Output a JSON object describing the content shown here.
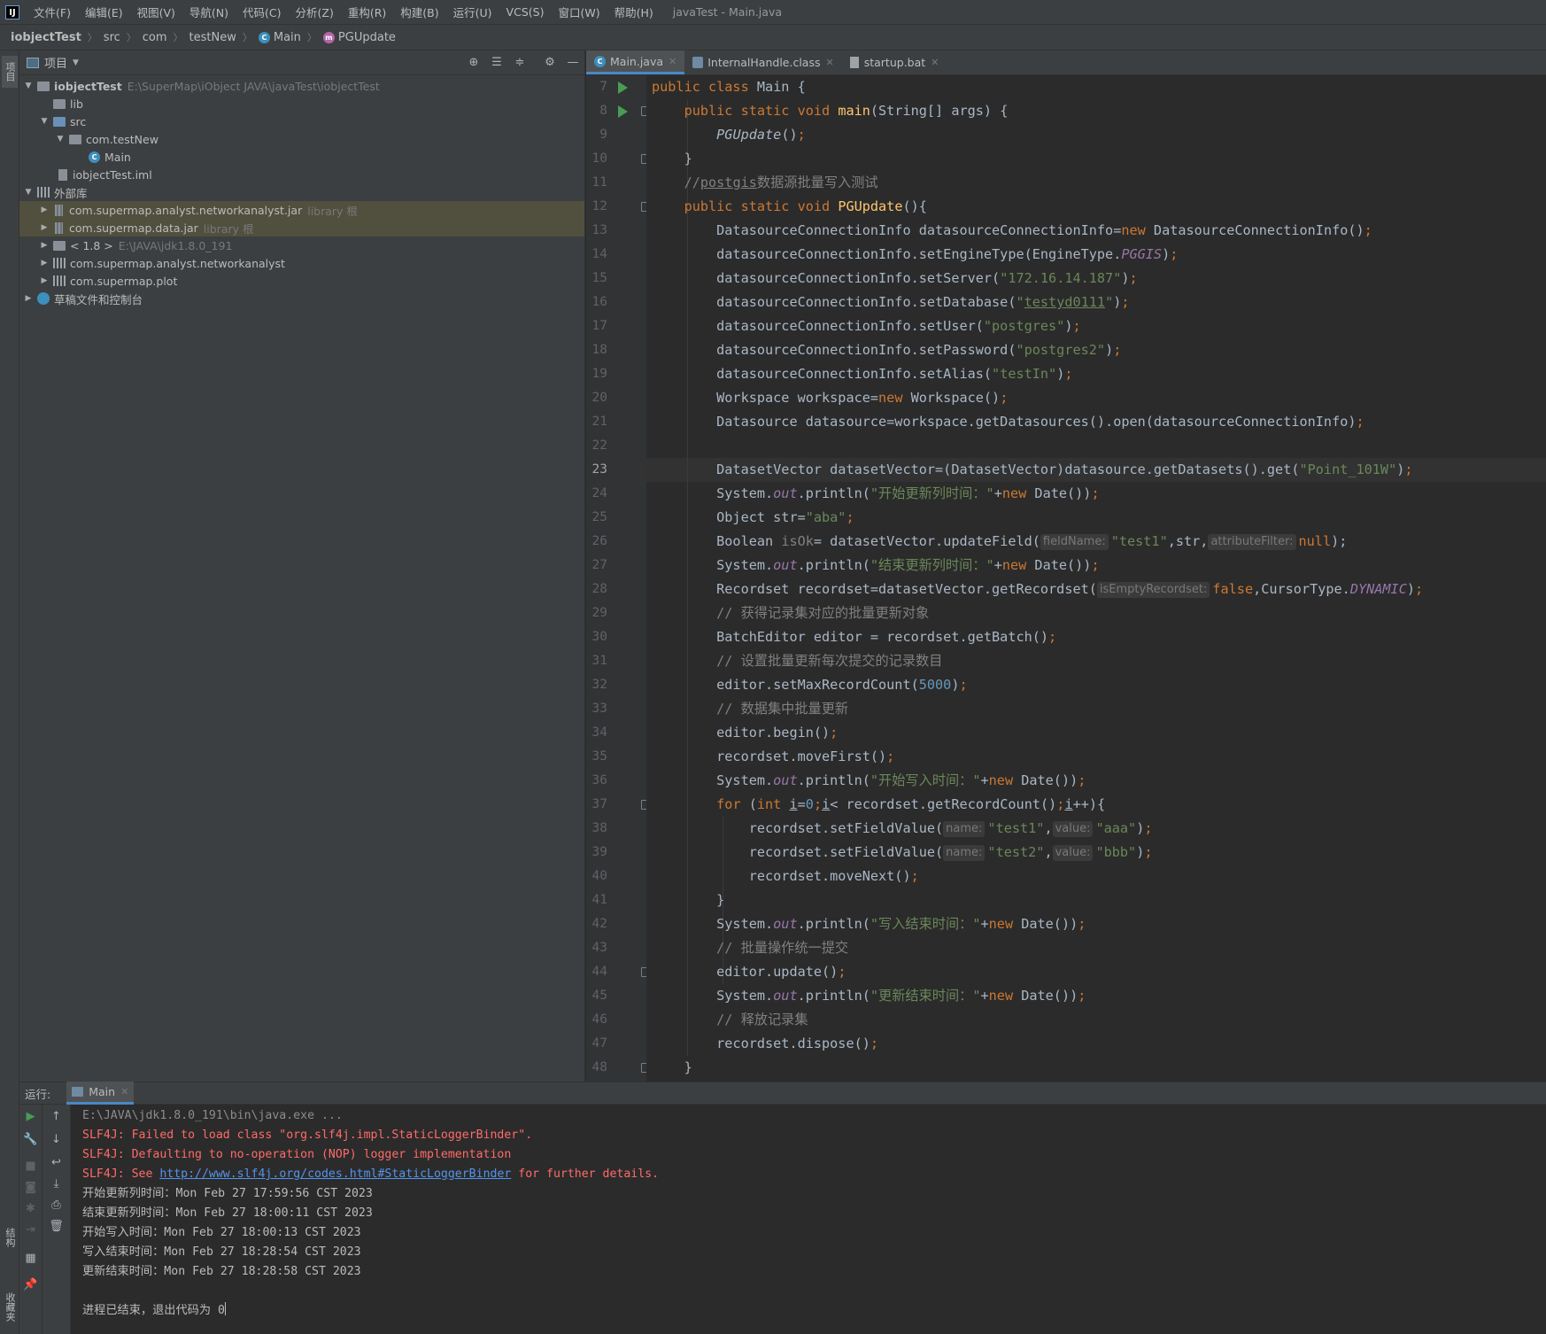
{
  "menu": {
    "items": [
      "文件(F)",
      "编辑(E)",
      "视图(V)",
      "导航(N)",
      "代码(C)",
      "分析(Z)",
      "重构(R)",
      "构建(B)",
      "运行(U)",
      "VCS(S)",
      "窗口(W)",
      "帮助(H)"
    ],
    "window_title": "javaTest - Main.java"
  },
  "breadcrumb": [
    "iobjectTest",
    "src",
    "com",
    "testNew",
    "Main",
    "PGUpdate"
  ],
  "left_strip": {
    "project": "项目",
    "structure": "结构",
    "favorites": "收藏夹"
  },
  "project_panel": {
    "title": "项目",
    "tree": [
      {
        "label": "iobjectTest",
        "hint": "E:\\SuperMap\\iObject JAVA\\javaTest\\iobjectTest"
      },
      {
        "label": "lib",
        "hint": ""
      },
      {
        "label": "src",
        "hint": ""
      },
      {
        "label": "com.testNew",
        "hint": ""
      },
      {
        "label": "Main",
        "hint": ""
      },
      {
        "label": "iobjectTest.iml",
        "hint": ""
      },
      {
        "label": "外部库",
        "hint": ""
      },
      {
        "label": "com.supermap.analyst.networkanalyst.jar",
        "hint": "library 根"
      },
      {
        "label": "com.supermap.data.jar",
        "hint": "library 根"
      },
      {
        "label": "< 1.8 >",
        "hint": "E:\\JAVA\\jdk1.8.0_191"
      },
      {
        "label": "com.supermap.analyst.networkanalyst",
        "hint": ""
      },
      {
        "label": "com.supermap.plot",
        "hint": ""
      },
      {
        "label": "草稿文件和控制台",
        "hint": ""
      }
    ]
  },
  "editor": {
    "tabs": [
      "Main.java",
      "InternalHandle.class",
      "startup.bat"
    ],
    "active_tab": "Main.java",
    "current_line": 23,
    "line_numbers": [
      "7",
      "8",
      "9",
      "10",
      "11",
      "12",
      "13",
      "14",
      "15",
      "16",
      "17",
      "18",
      "19",
      "20",
      "21",
      "22",
      "23",
      "24",
      "25",
      "26",
      "27",
      "28",
      "29",
      "30",
      "31",
      "32",
      "33",
      "34",
      "35",
      "36",
      "37",
      "38",
      "39",
      "40",
      "41",
      "42",
      "43",
      "44",
      "45",
      "46",
      "47",
      "48"
    ],
    "code": {
      "l7_a": "public class ",
      "l7_b": "Main {",
      "l8_a": "    public static void ",
      "l8_b": "main",
      "l8_c": "(String[] args) {",
      "l9_a": "        ",
      "l9_b": "PGUpdate",
      "l9_c": "()",
      "l9_d": ";",
      "l10": "    }",
      "l11_a": "    //",
      "l11_b": "postgis",
      "l11_c": "数据源批量写入测试",
      "l12_a": "    public static void ",
      "l12_b": "PGUpdate",
      "l12_c": "(){",
      "l13_a": "        DatasourceConnectionInfo datasourceConnectionInfo=",
      "l13_b": "new ",
      "l13_c": "DatasourceConnectionInfo()",
      "l13_d": ";",
      "l14_a": "        datasourceConnectionInfo.setEngineType(EngineType.",
      "l14_b": "PGGIS",
      "l14_c": ")",
      "l14_d": ";",
      "l15_a": "        datasourceConnectionInfo.setServer(",
      "l15_b": "\"172.16.14.187\"",
      "l15_c": ")",
      "l15_d": ";",
      "l16_a": "        datasourceConnectionInfo.setDatabase(",
      "l16_b": "\"",
      "l16_c": "testyd0111",
      "l16_d": "\"",
      "l16_e": ")",
      "l16_f": ";",
      "l17_a": "        datasourceConnectionInfo.setUser(",
      "l17_b": "\"postgres\"",
      "l17_c": ")",
      "l17_d": ";",
      "l18_a": "        datasourceConnectionInfo.setPassword(",
      "l18_b": "\"postgres2\"",
      "l18_c": ")",
      "l18_d": ";",
      "l19_a": "        datasourceConnectionInfo.setAlias(",
      "l19_b": "\"testIn\"",
      "l19_c": ")",
      "l19_d": ";",
      "l20_a": "        Workspace workspace=",
      "l20_b": "new ",
      "l20_c": "Workspace()",
      "l20_d": ";",
      "l21_a": "        Datasource datasource=workspace.getDatasources().open(datasourceConnectionInfo)",
      "l21_b": ";",
      "l23_a": "        DatasetVector datasetVector=(DatasetVector)datasource.getDatasets().get(",
      "l23_b": "\"Point_101W\"",
      "l23_c": ")",
      "l23_d": ";",
      "l24_a": "        System.",
      "l24_b": "out",
      "l24_c": ".println(",
      "l24_d": "\"开始更新列时间：\"",
      "l24_e": "+",
      "l24_f": "new ",
      "l24_g": "Date())",
      "l24_h": ";",
      "l25_a": "        Object str=",
      "l25_b": "\"aba\"",
      "l25_c": ";",
      "l26_a": "        Boolean ",
      "l26_b": "isOk",
      "l26_c": "= datasetVector.updateField(",
      "l26_h1": "fieldName:",
      "l26_d": "\"test1\"",
      "l26_e": ",str,",
      "l26_h2": "attributeFilter:",
      "l26_f": "null",
      "l26_g": ");",
      "l27_a": "        System.",
      "l27_b": "out",
      "l27_c": ".println(",
      "l27_d": "\"结束更新列时间：\"",
      "l27_e": "+",
      "l27_f": "new ",
      "l27_g": "Date())",
      "l27_h": ";",
      "l28_a": "        Recordset recordset=datasetVector.getRecordset(",
      "l28_h": "isEmptyRecordset:",
      "l28_b": "false",
      "l28_c": ",CursorType.",
      "l28_d": "DYNAMIC",
      "l28_e": ")",
      "l28_f": ";",
      "l29": "        // 获得记录集对应的批量更新对象",
      "l30_a": "        BatchEditor editor = recordset.getBatch()",
      "l30_b": ";",
      "l31": "        // 设置批量更新每次提交的记录数目",
      "l32_a": "        editor.setMaxRecordCount(",
      "l32_b": "5000",
      "l32_c": ")",
      "l32_d": ";",
      "l33": "        // 数据集中批量更新",
      "l34_a": "        editor.begin()",
      "l34_b": ";",
      "l35_a": "        recordset.moveFirst()",
      "l35_b": ";",
      "l36_a": "        System.",
      "l36_b": "out",
      "l36_c": ".println(",
      "l36_d": "\"开始写入时间：\"",
      "l36_e": "+",
      "l36_f": "new ",
      "l36_g": "Date())",
      "l36_h": ";",
      "l37_a": "        ",
      "l37_b": "for ",
      "l37_c": "(",
      "l37_d": "int ",
      "l37_e": "i",
      "l37_f": "=",
      "l37_g": "0",
      "l37_h": ";",
      "l37_i": "i",
      "l37_j": "< recordset.getRecordCount()",
      "l37_k": ";",
      "l37_l": "i",
      "l37_m": "++){",
      "l38_a": "            recordset.setFieldValue(",
      "l38_h1": "name:",
      "l38_b": "\"test1\"",
      "l38_c": ",",
      "l38_h2": "value:",
      "l38_d": "\"aaa\"",
      "l38_e": ")",
      "l38_f": ";",
      "l39_a": "            recordset.setFieldValue(",
      "l39_h1": "name:",
      "l39_b": "\"test2\"",
      "l39_c": ",",
      "l39_h2": "value:",
      "l39_d": "\"bbb\"",
      "l39_e": ")",
      "l39_f": ";",
      "l40_a": "            recordset.moveNext()",
      "l40_b": ";",
      "l41": "        }",
      "l42_a": "        System.",
      "l42_b": "out",
      "l42_c": ".println(",
      "l42_d": "\"写入结束时间：\"",
      "l42_e": "+",
      "l42_f": "new ",
      "l42_g": "Date())",
      "l42_h": ";",
      "l43": "        // 批量操作统一提交",
      "l44_a": "        editor.update()",
      "l44_b": ";",
      "l45_a": "        System.",
      "l45_b": "out",
      "l45_c": ".println(",
      "l45_d": "\"更新结束时间：\"",
      "l45_e": "+",
      "l45_f": "new ",
      "l45_g": "Date())",
      "l45_h": ";",
      "l46": "        // 释放记录集",
      "l47_a": "        recordset.dispose()",
      "l47_b": ";",
      "l48": "    }"
    }
  },
  "run_panel": {
    "label": "运行:",
    "tab": "Main",
    "console": {
      "cmd": "E:\\JAVA\\jdk1.8.0_191\\bin\\java.exe ...",
      "err1": "SLF4J: Failed to load class \"org.slf4j.impl.StaticLoggerBinder\".",
      "err2": "SLF4J: Defaulting to no-operation (NOP) logger implementation",
      "err3_a": "SLF4J: See ",
      "err3_link": "http://www.slf4j.org/codes.html#StaticLoggerBinder",
      "err3_b": " for further details.",
      "out1": "开始更新列时间：Mon Feb 27 17:59:56 CST 2023",
      "out2": "结束更新列时间：Mon Feb 27 18:00:11 CST 2023",
      "out3": "开始写入时间：Mon Feb 27 18:00:13 CST 2023",
      "out4": "写入结束时间：Mon Feb 27 18:28:54 CST 2023",
      "out5": "更新结束时间：Mon Feb 27 18:28:58 CST 2023",
      "exit": "进程已结束，退出代码为 0"
    }
  }
}
